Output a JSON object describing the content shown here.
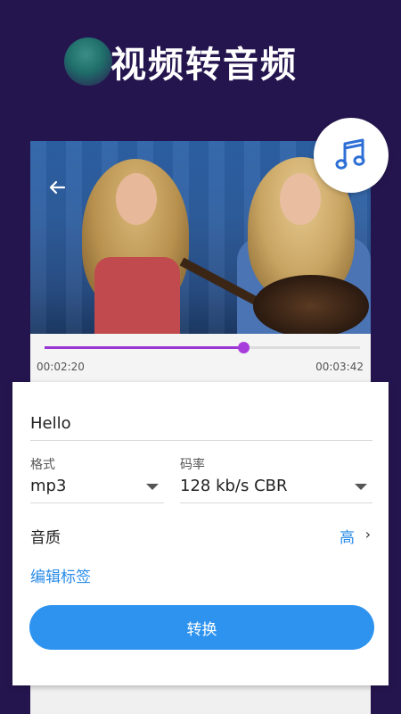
{
  "header": {
    "title": "视频转音频"
  },
  "player": {
    "current_time": "00:02:20",
    "total_time": "00:03:42",
    "progress": 0.63
  },
  "form": {
    "file_name": "Hello",
    "format_label": "格式",
    "format_value": "mp3",
    "bitrate_label": "码率",
    "bitrate_value": "128 kb/s CBR",
    "quality_label": "音质",
    "quality_value": "高",
    "edit_tags_label": "编辑标签",
    "convert_label": "转换"
  },
  "colors": {
    "background": "#25154f",
    "accent_blue": "#2e93ef",
    "seek_purple": "#9a36d4"
  },
  "icons": {
    "back": "back-arrow-icon",
    "music": "music-note-icon",
    "dropdown": "chevron-down-icon",
    "quality_more": "chevron-right-icon"
  }
}
